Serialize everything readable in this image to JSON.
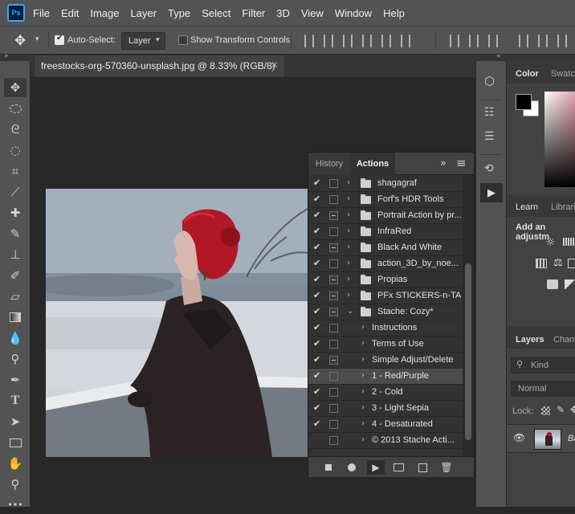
{
  "app": {
    "logo_text": "Ps"
  },
  "menubar": {
    "items": [
      "File",
      "Edit",
      "Image",
      "Layer",
      "Type",
      "Select",
      "Filter",
      "3D",
      "View",
      "Window",
      "Help"
    ]
  },
  "options_bar": {
    "move_tool_icon": "move-icon",
    "auto_select_label": "Auto-Select:",
    "auto_select_checked": true,
    "auto_select_target": "Layer",
    "show_transform_label": "Show Transform Controls",
    "show_transform_checked": false
  },
  "document": {
    "tab_title": "freestocks-org-570360-unsplash.jpg @ 8.33% (RGB/8)",
    "close_glyph": "×"
  },
  "actions_panel": {
    "tabs": [
      {
        "label": "History",
        "active": false
      },
      {
        "label": "Actions",
        "active": true
      }
    ],
    "expand_glyph": "»",
    "menu_glyph": "≡",
    "rows": [
      {
        "checked": true,
        "dialog": false,
        "indent": 0,
        "type": "set",
        "expanded": false,
        "label": "shagagraf",
        "selected": false
      },
      {
        "checked": true,
        "dialog": false,
        "indent": 0,
        "type": "set",
        "expanded": false,
        "label": "Forf's HDR Tools",
        "selected": false
      },
      {
        "checked": true,
        "dialog": true,
        "indent": 0,
        "type": "set",
        "expanded": false,
        "label": "Portrait Action by pr...",
        "selected": false
      },
      {
        "checked": true,
        "dialog": false,
        "indent": 0,
        "type": "set",
        "expanded": false,
        "label": "InfraRed",
        "selected": false
      },
      {
        "checked": true,
        "dialog": true,
        "indent": 0,
        "type": "set",
        "expanded": false,
        "label": "Black And White",
        "selected": false
      },
      {
        "checked": true,
        "dialog": false,
        "indent": 0,
        "type": "set",
        "expanded": false,
        "label": "action_3D_by_noe...",
        "selected": false
      },
      {
        "checked": true,
        "dialog": true,
        "indent": 0,
        "type": "set",
        "expanded": false,
        "label": "Propias",
        "selected": false
      },
      {
        "checked": true,
        "dialog": true,
        "indent": 0,
        "type": "set",
        "expanded": false,
        "label": "PFx STICKERS-n-TA...",
        "selected": false
      },
      {
        "checked": true,
        "dialog": true,
        "indent": 0,
        "type": "set",
        "expanded": true,
        "label": "Stache: Cozy*",
        "selected": false
      },
      {
        "checked": true,
        "dialog": false,
        "indent": 1,
        "type": "action",
        "expanded": false,
        "label": "Instructions",
        "selected": false
      },
      {
        "checked": true,
        "dialog": false,
        "indent": 1,
        "type": "action",
        "expanded": false,
        "label": "Terms of Use",
        "selected": false
      },
      {
        "checked": true,
        "dialog": true,
        "indent": 1,
        "type": "action",
        "expanded": false,
        "label": "Simple Adjust/Delete",
        "selected": false
      },
      {
        "checked": true,
        "dialog": false,
        "indent": 1,
        "type": "action",
        "expanded": false,
        "label": "1 - Red/Purple",
        "selected": true
      },
      {
        "checked": true,
        "dialog": false,
        "indent": 1,
        "type": "action",
        "expanded": false,
        "label": "2 - Cold",
        "selected": false
      },
      {
        "checked": true,
        "dialog": false,
        "indent": 1,
        "type": "action",
        "expanded": false,
        "label": "3 - Light Sepia",
        "selected": false
      },
      {
        "checked": true,
        "dialog": false,
        "indent": 1,
        "type": "action",
        "expanded": false,
        "label": "4 - Desaturated",
        "selected": false
      },
      {
        "checked": false,
        "dialog": false,
        "indent": 1,
        "type": "action",
        "expanded": false,
        "label": "© 2013 Stache Acti...",
        "selected": false
      }
    ],
    "footer_buttons": [
      "stop-icon",
      "record-icon",
      "play-icon",
      "new-set-icon",
      "new-action-icon",
      "delete-icon"
    ]
  },
  "right_panels": {
    "color_tabs": [
      "Color",
      "Swatch"
    ],
    "learn_tabs": [
      "Learn",
      "Librari"
    ],
    "adjustments_label": "Add an adjustm",
    "layers_tabs": [
      "Layers",
      "Chann"
    ],
    "kind_label": "Kind",
    "blend_mode": "Normal",
    "lock_label": "Lock:",
    "layer_name": "Ba",
    "foreground_color": "#000000",
    "background_color": "#ffffff"
  },
  "colors": {
    "menubar": "#535353",
    "panel": "#424242",
    "canvas": "#282828",
    "accent": "#31a8ff"
  }
}
